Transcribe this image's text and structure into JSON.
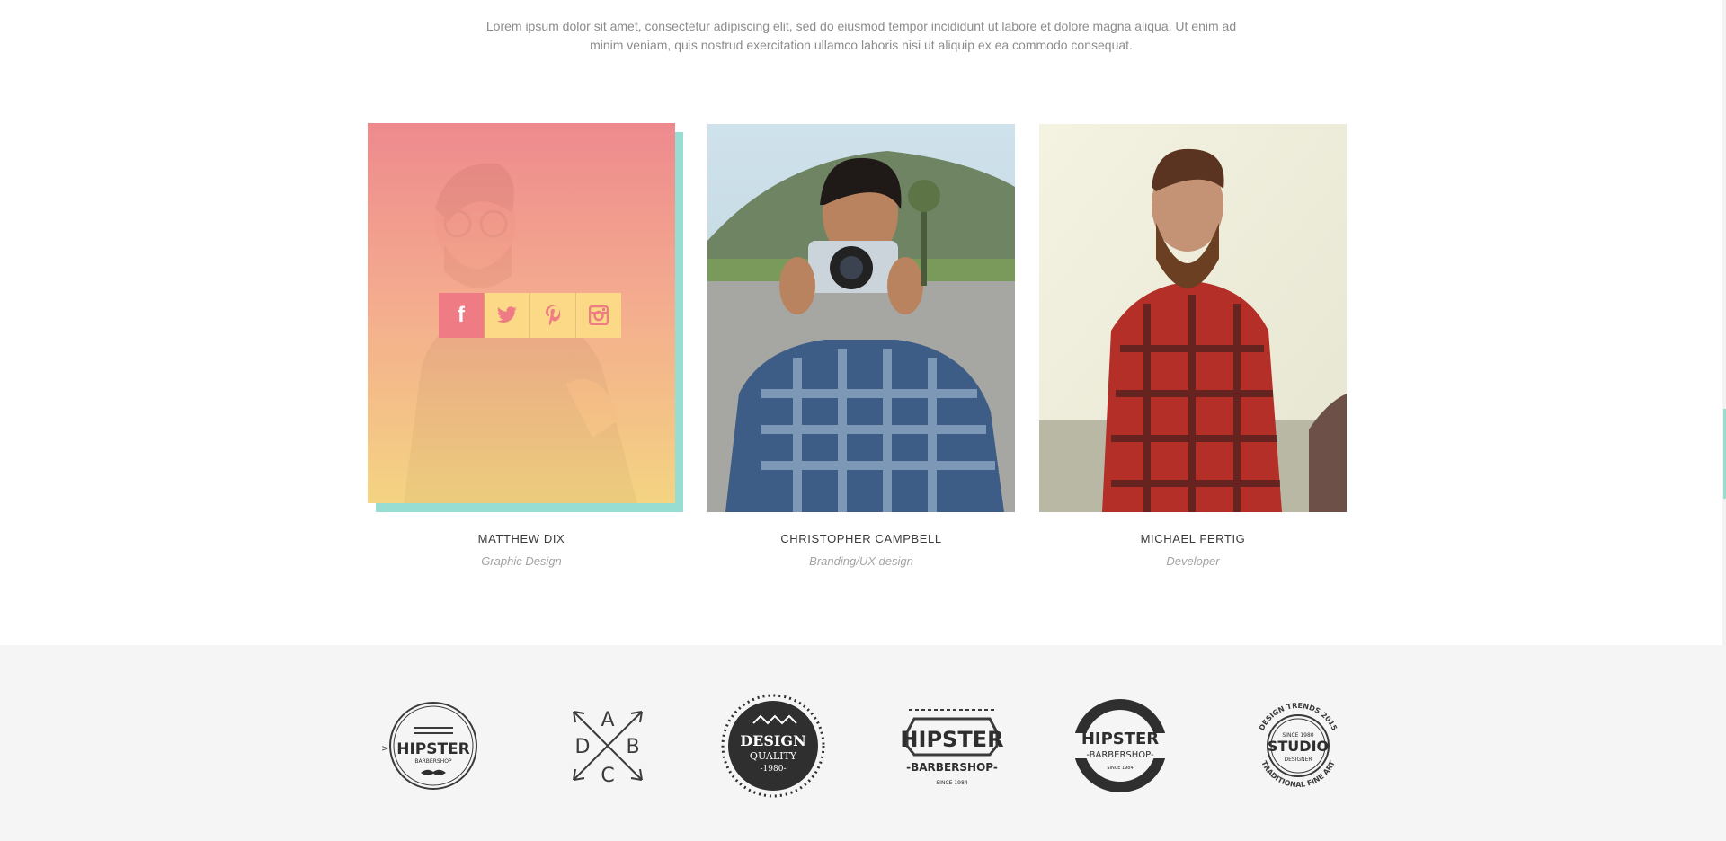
{
  "intro": {
    "line1": "Lorem ipsum dolor sit amet, consectetur adipiscing elit, sed do eiusmod tempor incididunt ut labore et dolore magna aliqua. Ut enim ad",
    "line2": "minim veniam, quis nostrud exercitation ullamco laboris nisi ut aliquip ex ea commodo consequat."
  },
  "team": [
    {
      "name": "MATTHEW DIX",
      "role": "Graphic Design"
    },
    {
      "name": "CHRISTOPHER CAMPBELL",
      "role": "Branding/UX design"
    },
    {
      "name": "MICHAEL FERTIG",
      "role": "Developer"
    }
  ],
  "social": {
    "icons": [
      "facebook-icon",
      "twitter-icon",
      "pinterest-icon",
      "instagram-icon"
    ],
    "facebook_letter": "f"
  },
  "logos": [
    {
      "name": "hipster-barbershop-mustache",
      "title": "HIPSTER",
      "sub": "BARBERSHOP",
      "mark": ">"
    },
    {
      "name": "arrows-abcd",
      "letters": [
        "A",
        "B",
        "C",
        "D"
      ]
    },
    {
      "name": "design-quality",
      "title": "DESIGN",
      "sub": "QUALITY",
      "year": "-1980-"
    },
    {
      "name": "hipster-barbershop-banner",
      "title": "HIPSTER",
      "sub": "-BARBERSHOP-",
      "since": "SINCE 1984"
    },
    {
      "name": "hipster-barbershop-ring",
      "title": "HIPSTER",
      "sub": "-BARBERSHOP-",
      "since": "SINCE 1984"
    },
    {
      "name": "studio-designer",
      "arc_top": "DESIGN TRENDS 2015",
      "since": "SINCE 1980",
      "title": "STUDIO",
      "sub": "DESIGNER",
      "arc_bottom": "TRADITIONAL FINE ART"
    }
  ],
  "colors": {
    "teal": "#97ddd1",
    "pink": "#ef7c85",
    "yellow": "#fbd986",
    "text_muted": "#8c8c8c",
    "logos_bg": "#f5f5f5"
  }
}
